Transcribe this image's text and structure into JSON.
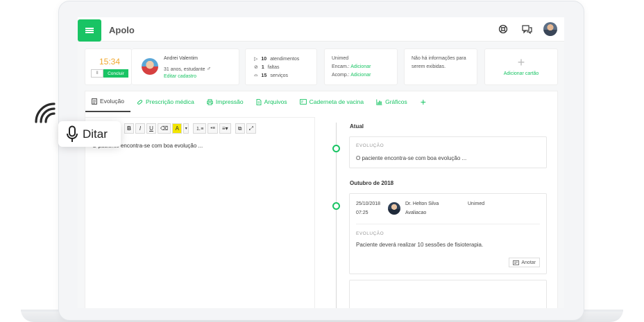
{
  "app": {
    "title": "Apolo"
  },
  "timer": {
    "time": "15:34",
    "pause": "II",
    "finish_label": "Concluir"
  },
  "patient": {
    "name": "Andrei Valentim",
    "info": "31 anos, estudante",
    "edit_link": "Editar cadastro"
  },
  "stats": [
    {
      "value": "10",
      "label": "atendimentos"
    },
    {
      "value": "1",
      "label": "faltas"
    },
    {
      "value": "15",
      "label": "serviços"
    }
  ],
  "insurance": {
    "name": "Unimed",
    "encam_label": "Encam.:",
    "encam_link": "Adicionar",
    "acomp_label": "Acomp.:",
    "acomp_link": "Adicionar"
  },
  "info_card": {
    "text_line1": "Não há informações para",
    "text_line2": "serem exibidas."
  },
  "add_card": {
    "label": "Adicionar cartão"
  },
  "tabs": [
    {
      "label": "Evolução",
      "icon": "document-icon"
    },
    {
      "label": "Prescrição médica",
      "icon": "pill-icon"
    },
    {
      "label": "Impressão",
      "icon": "printer-icon"
    },
    {
      "label": "Arquivos",
      "icon": "file-icon"
    },
    {
      "label": "Caderneta de vacina",
      "icon": "card-icon"
    },
    {
      "label": "Gráficos",
      "icon": "chart-icon"
    }
  ],
  "toolbar": {
    "bold": "B",
    "italic": "I",
    "underline": "U",
    "highlight": "A"
  },
  "editor": {
    "text": "O paciente encontra-se com boa evolução ..."
  },
  "timeline": {
    "current_heading": "Atual",
    "current_label": "EVOLUÇÃO",
    "current_text": "O paciente encontra-se com boa evolução ...",
    "month_heading": "Outubro de 2018",
    "entry_date": "25/10/2018",
    "entry_time": "07:25",
    "doctor_name": "Dr. Helton Silva",
    "doctor_type": "Avaliacao",
    "entry_insurance": "Unimed",
    "entry_label": "EVOLUÇÃO",
    "entry_text": "Paciente deverá realizar 10 sessões de fisioterapia.",
    "annotate_label": "Anotar"
  },
  "dictation": {
    "label": "Ditar"
  },
  "colors": {
    "brand_green": "#19c464",
    "timer_orange": "#f0a830",
    "highlight_yellow": "#f3e600"
  }
}
